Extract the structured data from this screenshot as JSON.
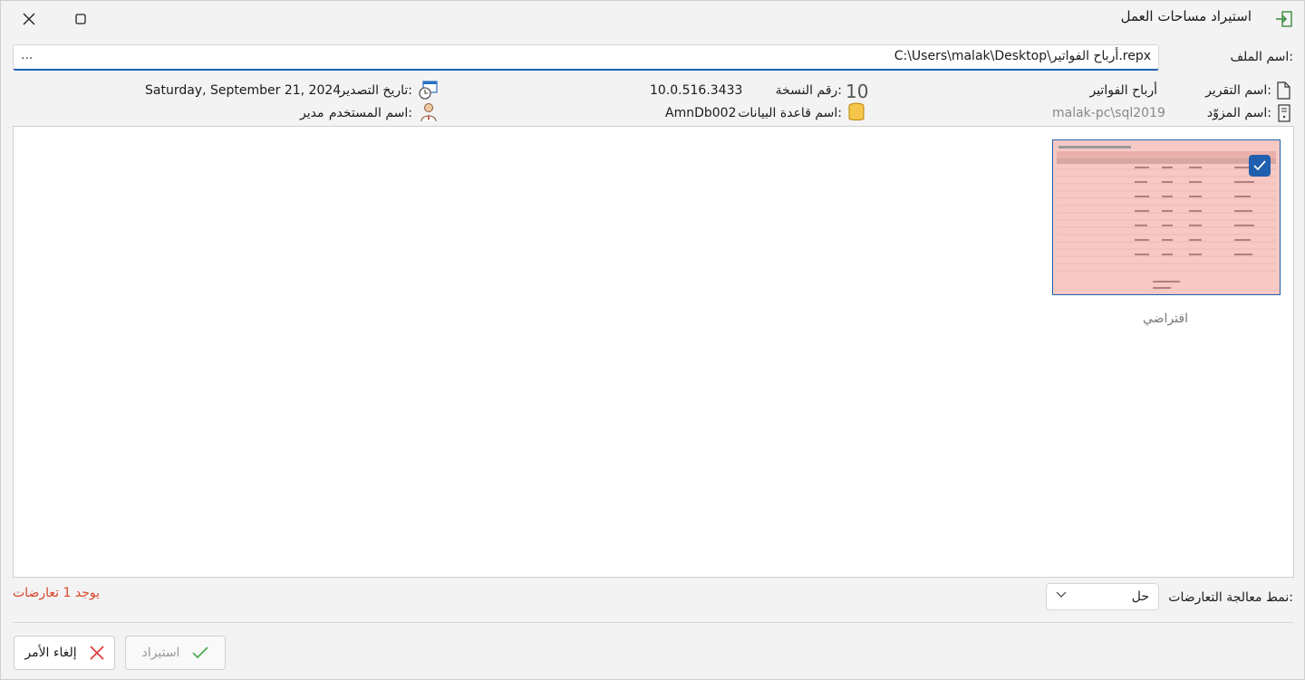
{
  "title": "استيراد مساحات العمل",
  "file": {
    "label": "اسم الملف:",
    "path": "C:\\Users\\malak\\Desktop\\أرباح الفواتير.repx",
    "browse": "..."
  },
  "info": {
    "report_name_label": "اسم التقرير:",
    "report_name": "أرباح الفواتير",
    "provider_label": "اسم المزوّد:",
    "provider": "malak-pc\\sql2019",
    "version_label": "رقم النسخة:",
    "version": "10.0.516.3433",
    "db_label": "اسم قاعدة البيانات:",
    "db": "AmnDb002",
    "export_date_label": "تاريخ التصدير:",
    "export_date": "Saturday, September 21, 2024",
    "user_label": "اسم المستخدم:",
    "user": "مدير"
  },
  "layout_item": {
    "label": "افتراضي",
    "checked": true
  },
  "conflicts": {
    "message": "يوجد 1 تعارضات",
    "mode_label": "نمط معالجة التعارضات:",
    "mode_value": "حل"
  },
  "buttons": {
    "import": "استيراد",
    "cancel": "إلغاء الأمر"
  },
  "colors": {
    "accent": "#1f5fae",
    "error": "#d9452b",
    "thumb_bg": "#f7c9c4"
  }
}
